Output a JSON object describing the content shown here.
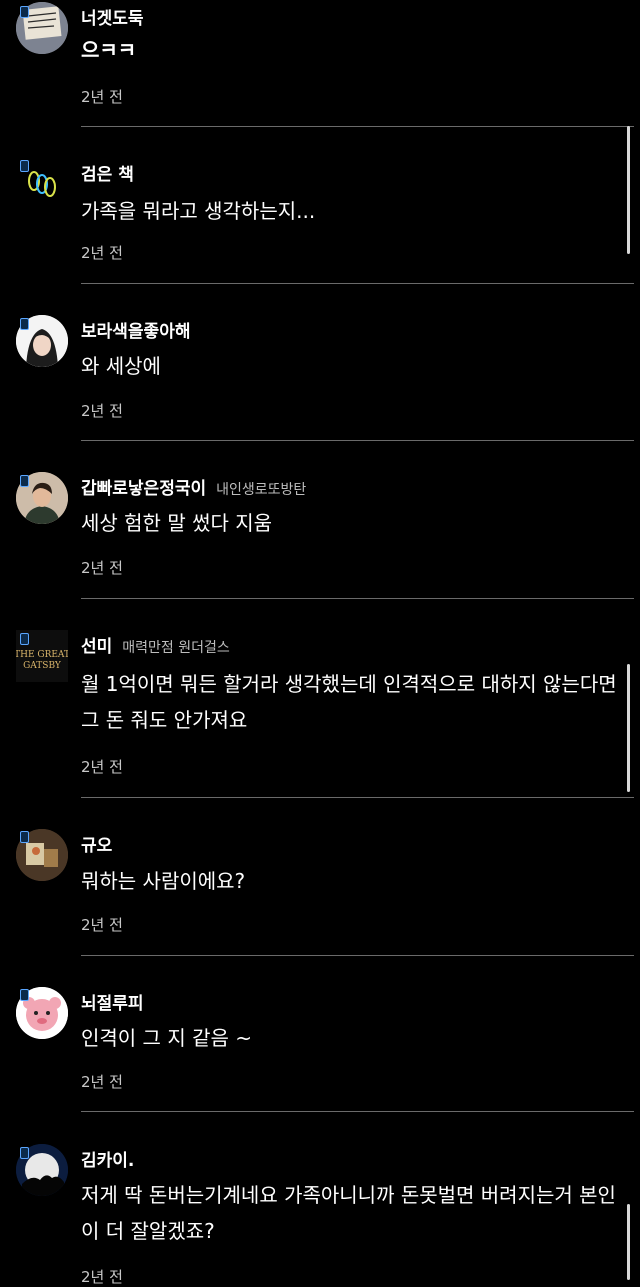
{
  "comments": [
    {
      "name": "너겟도둑",
      "badge_text": "",
      "text": "으ㅋㅋ",
      "time": "2년 전",
      "avatar_text": "Good luck Stay Weird"
    },
    {
      "name": "검은 책",
      "badge_text": "",
      "text": "가족을 뭐라고 생각하는지...",
      "time": "2년 전"
    },
    {
      "name": "보라색을좋아해",
      "badge_text": "",
      "text": "와 세상에",
      "time": "2년 전"
    },
    {
      "name": "갑빠로낳은정국이",
      "badge_text": "내인생로또방탄",
      "text": "세상 험한 말 썼다 지움",
      "time": "2년 전"
    },
    {
      "name": "선미",
      "badge_text": "매력만점 원더걸스",
      "text": "월 1억이면 뭐든 할거라 생각했는데 인격적으로 대하지 않는다면 그 돈 줘도 안가져요",
      "time": "2년 전",
      "avatar_text": "THE GREAT GATSBY"
    },
    {
      "name": "규오",
      "badge_text": "",
      "text": "뭐하는 사람이에요?",
      "time": "2년 전"
    },
    {
      "name": "뇌절루피",
      "badge_text": "",
      "text": "인격이 그 지 같음 ~",
      "time": "2년 전"
    },
    {
      "name": "김카이.",
      "badge_text": "",
      "text": "저게 딱 돈버는기계네요 가족아니니까 돈못벌면 버려지는거 본인이 더 잘알겠죠?",
      "time": "2년 전"
    }
  ],
  "icons": {
    "avatar_1": "sign-photo-avatar",
    "avatar_2": "rings-avatar",
    "avatar_3": "portrait-avatar",
    "avatar_4": "portrait-avatar",
    "avatar_5": "gatsby-poster-avatar",
    "avatar_6": "photo-avatar",
    "avatar_7": "pink-character-avatar",
    "avatar_8": "moon-silhouette-avatar"
  }
}
